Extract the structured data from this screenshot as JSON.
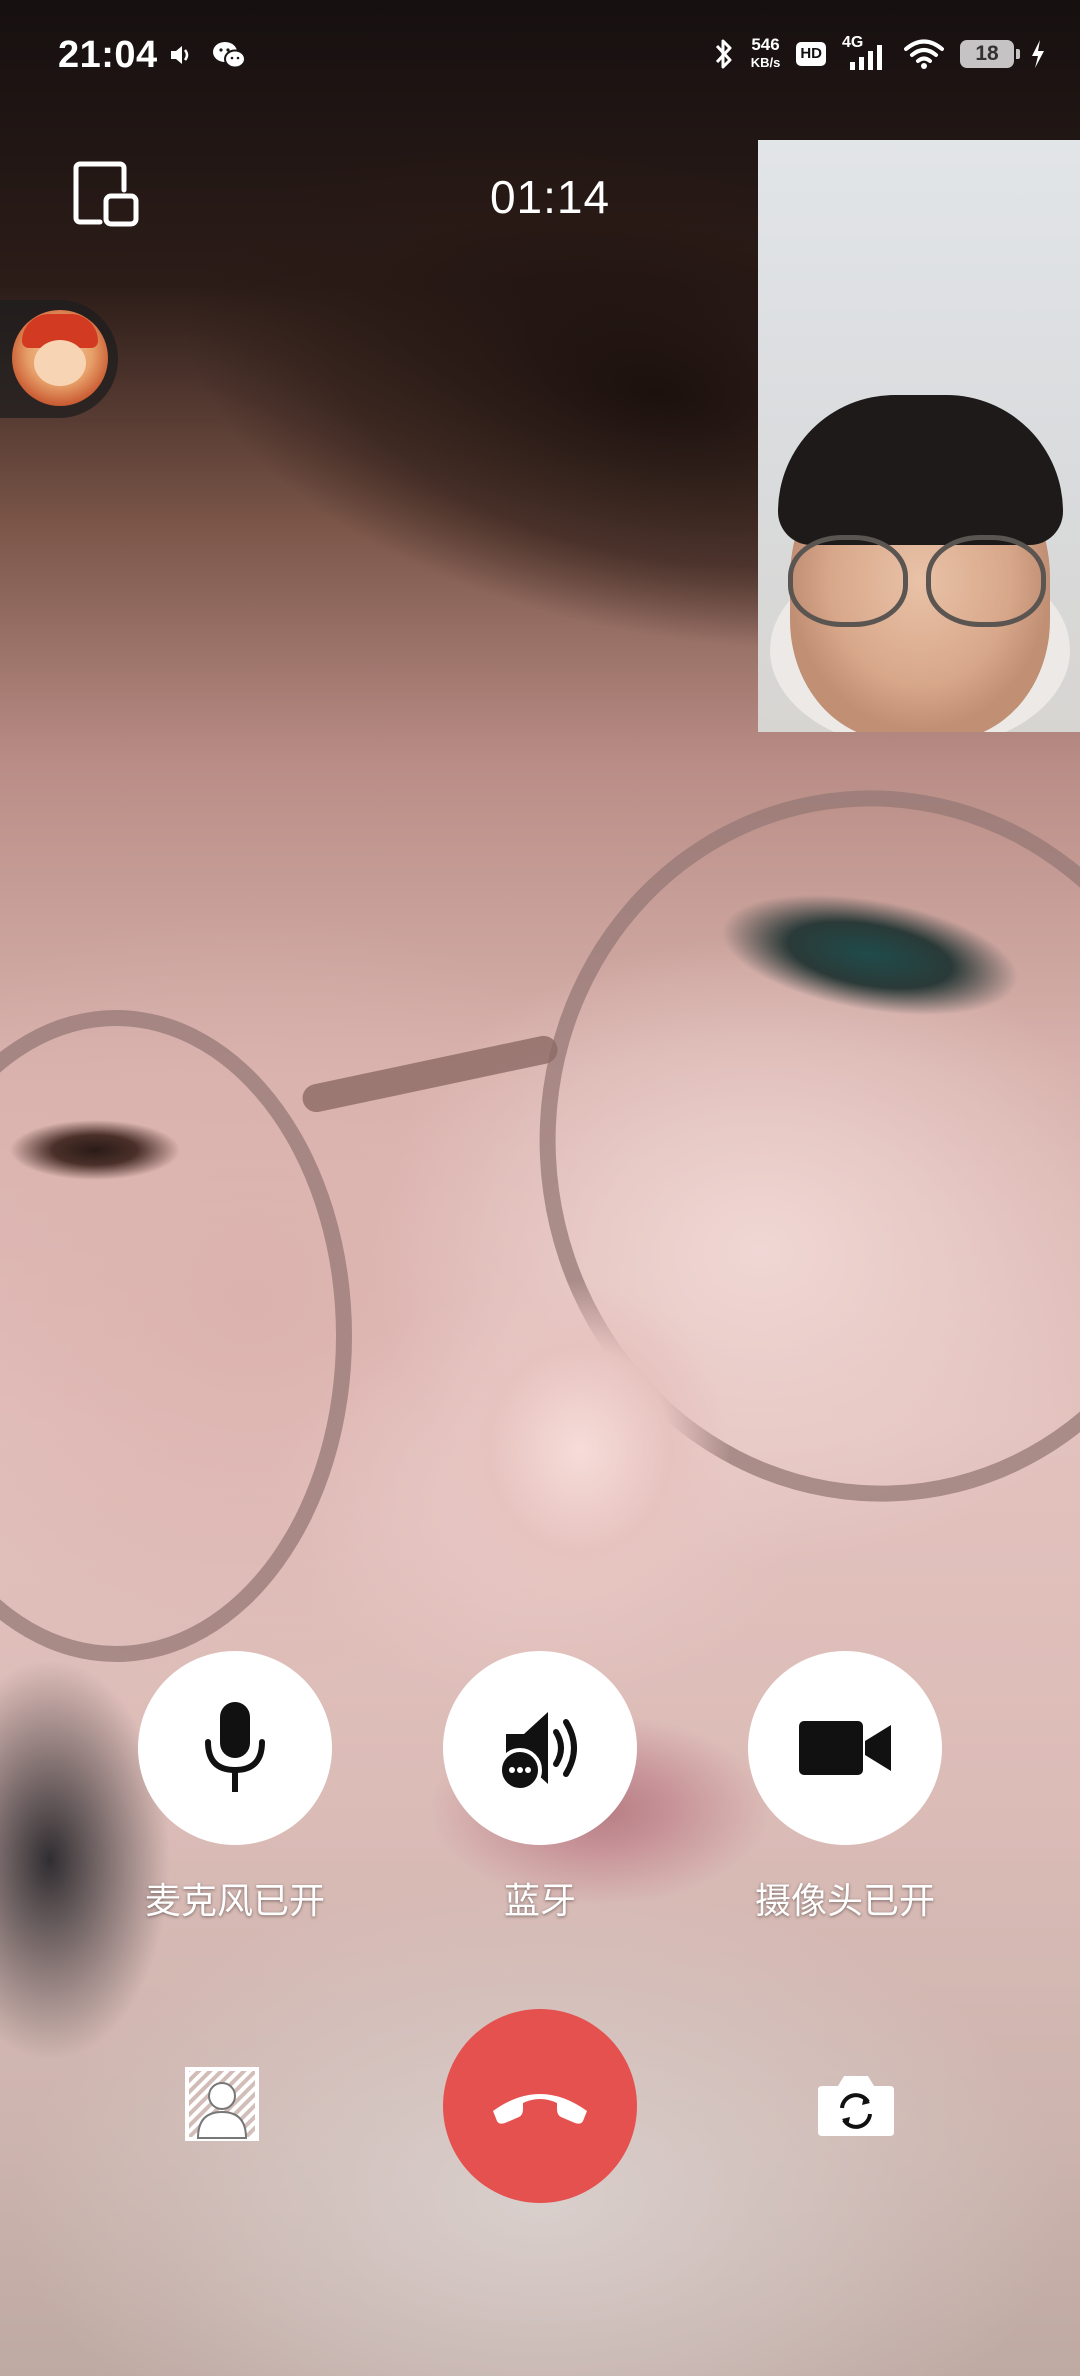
{
  "status_bar": {
    "time": "21:04",
    "left_icons": [
      "volume-icon",
      "wechat-icon"
    ],
    "net_speed_value": "546",
    "net_speed_unit": "KB/s",
    "hd_label": "HD",
    "network_type": "4G",
    "battery_level": "18",
    "right_icons": [
      "bluetooth-icon",
      "signal-icon",
      "wifi-icon",
      "charging-icon"
    ]
  },
  "call": {
    "timer": "01:14",
    "minimize_icon": "minimize-window-icon"
  },
  "floating_bubble": {
    "icon": "app-avatar-icon"
  },
  "controls": {
    "mic_label": "麦克风已开",
    "speaker_label": "蓝牙",
    "camera_label": "摄像头已开",
    "hangup_icon": "hangup-icon",
    "background_icon": "background-blur-icon",
    "switch_camera_icon": "switch-camera-icon"
  },
  "colors": {
    "hangup": "#e4514f",
    "control_bg": "#ffffff",
    "text": "#ffffff"
  }
}
